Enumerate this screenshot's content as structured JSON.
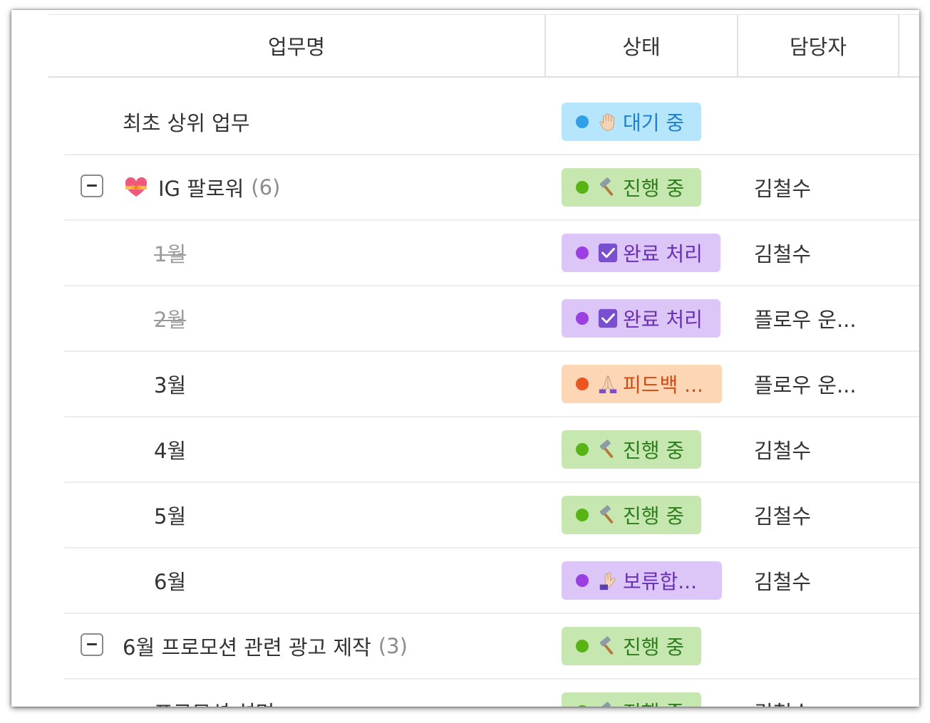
{
  "header": {
    "col_task": "업무명",
    "col_status": "상태",
    "col_assignee": "담당자"
  },
  "rows": [
    {
      "name": "최초 상위 업무",
      "status": "대기 중",
      "status_icon": "raised-hand-icon",
      "assignee": ""
    },
    {
      "name": "IG 팔로워",
      "count": "(6)",
      "status": "진행 중",
      "status_icon": "hammer-icon",
      "assignee": "김철수"
    },
    {
      "name": "1월",
      "status": "완료 처리",
      "status_icon": "check-box-icon",
      "assignee": "김철수"
    },
    {
      "name": "2월",
      "status": "완료 처리",
      "status_icon": "check-box-icon",
      "assignee": "플로우 운..."
    },
    {
      "name": "3월",
      "status": "피드백 ...",
      "status_icon": "folded-hands-icon",
      "assignee": "플로우 운..."
    },
    {
      "name": "4월",
      "status": "진행 중",
      "status_icon": "hammer-icon",
      "assignee": "김철수"
    },
    {
      "name": "5월",
      "status": "진행 중",
      "status_icon": "hammer-icon",
      "assignee": "김철수"
    },
    {
      "name": "6월",
      "status": "보류합...",
      "status_icon": "stop-hand-icon",
      "assignee": "김철수"
    },
    {
      "name": "6월 프로모션 관련 광고 제작",
      "count": "(3)",
      "status": "진행 중",
      "status_icon": "hammer-icon",
      "assignee": ""
    },
    {
      "name": "프로모션 설명",
      "status": "진행 중",
      "status_icon": "hammer-icon",
      "assignee": "김철수"
    }
  ],
  "colors": {
    "waiting": "#b5e6fb",
    "in_progress": "#c6e8b0",
    "done": "#dcc6f7",
    "feedback": "#fdd6b5",
    "on_hold": "#dcc6f7"
  }
}
